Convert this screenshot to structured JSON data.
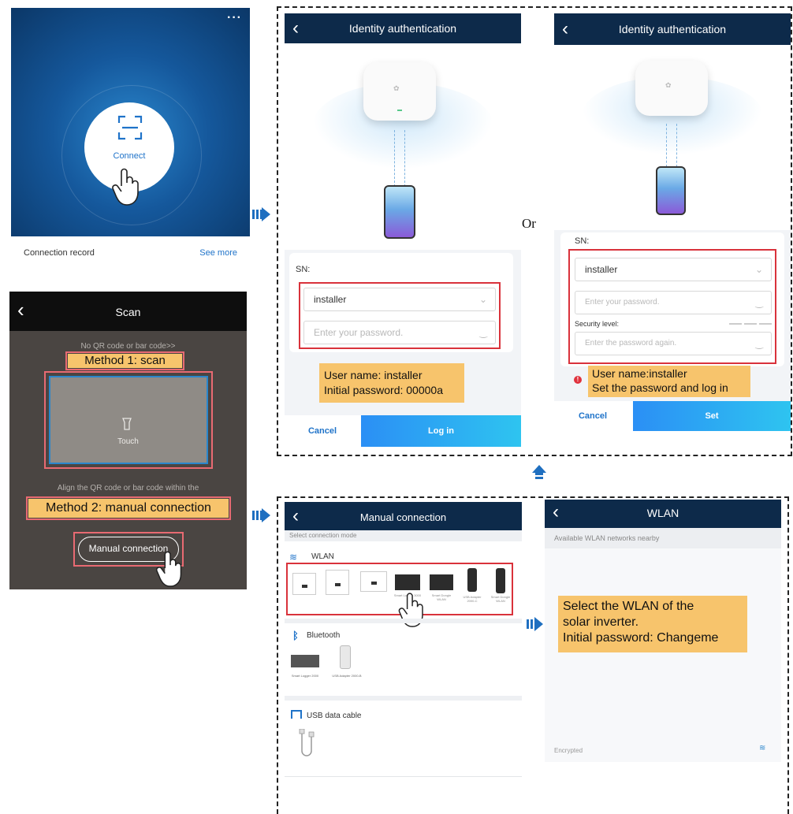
{
  "connect_screen": {
    "more_icon": "more-dots-icon",
    "connect_label": "Connect",
    "scan_icon": "scan-frame-icon",
    "record_label": "Connection record",
    "see_more": "See more"
  },
  "scan_screen": {
    "title": "Scan",
    "hint_top": "No QR code or bar code>>",
    "method1": "Method 1: scan",
    "touch_label": "Touch",
    "hint_bottom": "Align the QR code or bar code within the",
    "method2": "Method 2: manual connection",
    "manual_button": "Manual connection"
  },
  "auth1": {
    "title": "Identity authentication",
    "sn_label": "SN:",
    "user_value": "installer",
    "password_placeholder": "Enter your password.",
    "callout_line1": "User name: installer",
    "callout_line2": "Initial password: 00000a",
    "cancel": "Cancel",
    "login": "Log in"
  },
  "or_label": "Or",
  "auth2": {
    "title": "Identity authentication",
    "sn_label": "SN:",
    "user_value": "installer",
    "password_placeholder": "Enter your password.",
    "security_label": "Security level:",
    "confirm_placeholder": "Enter the password again.",
    "callout_line1": "User name:installer",
    "callout_line2": "Set the password and log in",
    "cancel": "Cancel",
    "set": "Set"
  },
  "manual_screen": {
    "title": "Manual connection",
    "mode_label": "Select connection mode",
    "wlan_label": "WLAN",
    "wlan_devices": [
      "",
      "",
      "",
      "Smart Logger 3000",
      "Smart Dongle WLAN",
      "USB Adapter 2000-C",
      "Smart Dongle WLAN"
    ],
    "bluetooth_label": "Bluetooth",
    "bt_devices": [
      "Smart Logger 2000",
      "USB Adapter 2000-B"
    ],
    "usb_label": "USB data cable"
  },
  "wlan_screen": {
    "title": "WLAN",
    "subtitle": "Available WLAN networks nearby",
    "callout_line1": "Select the WLAN of the",
    "callout_line2": "solar inverter.",
    "callout_line3": "Initial password: Changeme",
    "encrypted_label": "Encrypted"
  },
  "colors": {
    "navbar": "#0d2a4a",
    "accent_blue": "#2aa7f0",
    "callout": "#f7c46c",
    "highlight_red": "#d9323b"
  }
}
